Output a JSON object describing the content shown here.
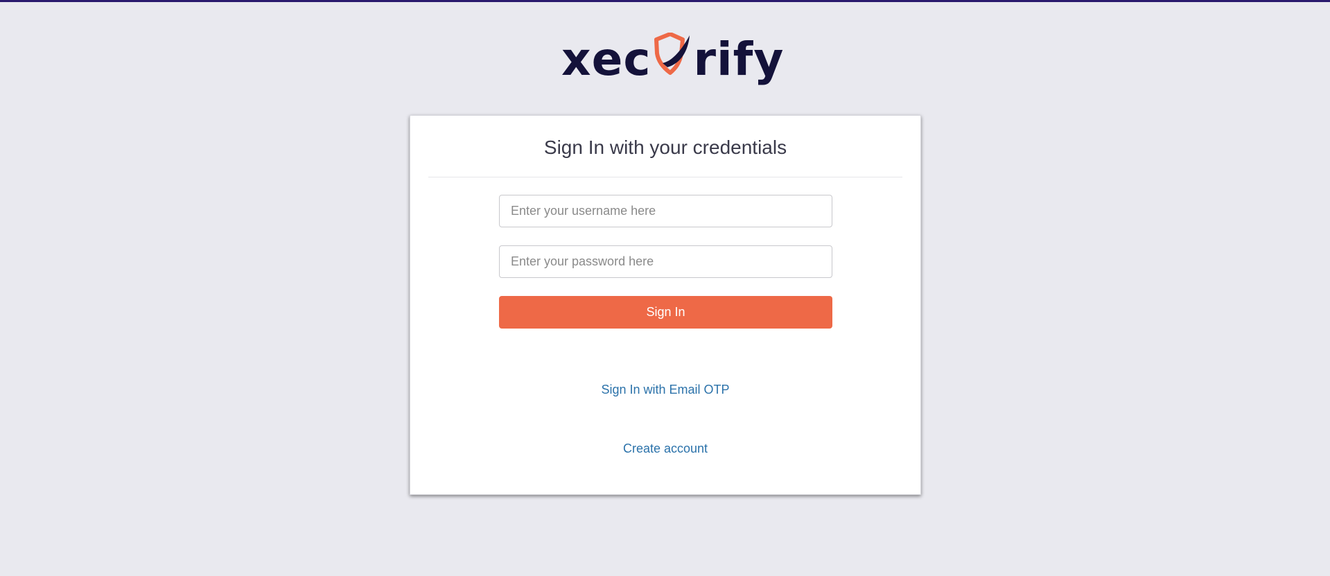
{
  "brand": {
    "logo_prefix": "xec",
    "logo_suffix": "rify",
    "logo_text_color": "#14123a",
    "shield_color": "#ee6947",
    "swoosh_color": "#14123a"
  },
  "colors": {
    "top_bar": "#2a1a6e",
    "background": "#e9e9ef",
    "primary_button": "#ee6947",
    "link": "#2b72aa"
  },
  "login": {
    "title": "Sign In with your credentials",
    "username_placeholder": "Enter your username here",
    "password_placeholder": "Enter your password here",
    "username_value": "",
    "password_value": "",
    "submit_label": "Sign In",
    "otp_link": "Sign In with Email OTP",
    "create_account_link": "Create account"
  }
}
